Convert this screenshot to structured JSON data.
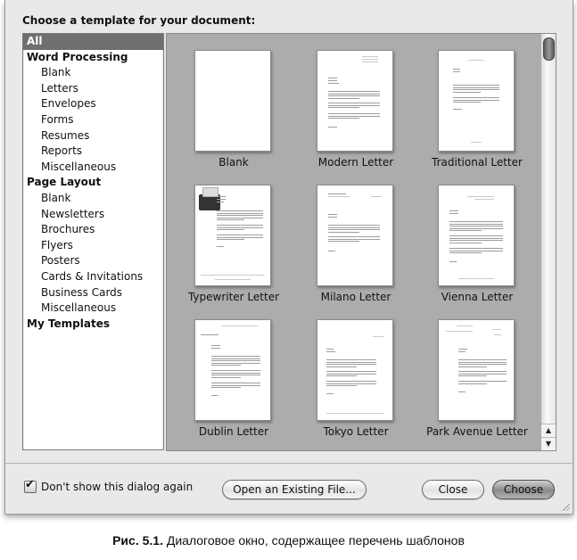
{
  "dialog": {
    "prompt": "Choose a template for your document:"
  },
  "sidebar": {
    "items": [
      {
        "label": "All",
        "type": "group",
        "selected": true
      },
      {
        "label": "Word Processing",
        "type": "group"
      },
      {
        "label": "Blank",
        "type": "sub"
      },
      {
        "label": "Letters",
        "type": "sub"
      },
      {
        "label": "Envelopes",
        "type": "sub"
      },
      {
        "label": "Forms",
        "type": "sub"
      },
      {
        "label": "Resumes",
        "type": "sub"
      },
      {
        "label": "Reports",
        "type": "sub"
      },
      {
        "label": "Miscellaneous",
        "type": "sub"
      },
      {
        "label": "Page Layout",
        "type": "group"
      },
      {
        "label": "Blank",
        "type": "sub"
      },
      {
        "label": "Newsletters",
        "type": "sub"
      },
      {
        "label": "Brochures",
        "type": "sub"
      },
      {
        "label": "Flyers",
        "type": "sub"
      },
      {
        "label": "Posters",
        "type": "sub"
      },
      {
        "label": "Cards & Invitations",
        "type": "sub"
      },
      {
        "label": "Business Cards",
        "type": "sub"
      },
      {
        "label": "Miscellaneous",
        "type": "sub"
      },
      {
        "label": "My Templates",
        "type": "group"
      }
    ]
  },
  "templates": [
    {
      "label": "Blank",
      "style": "blank"
    },
    {
      "label": "Modern Letter",
      "style": "modern"
    },
    {
      "label": "Traditional Letter",
      "style": "traditional"
    },
    {
      "label": "Typewriter Letter",
      "style": "typewriter"
    },
    {
      "label": "Milano Letter",
      "style": "milano"
    },
    {
      "label": "Vienna Letter",
      "style": "vienna"
    },
    {
      "label": "Dublin Letter",
      "style": "dublin"
    },
    {
      "label": "Tokyo Letter",
      "style": "tokyo"
    },
    {
      "label": "Park Avenue Letter",
      "style": "parkavenue"
    }
  ],
  "scrollbar": {
    "up_icon": "▲",
    "down_icon": "▼",
    "position_fraction": 0.0
  },
  "footer": {
    "checkbox_label": "Don't show this dialog again",
    "checkbox_checked": true,
    "checkmark": "✔",
    "open_existing_label": "Open an Existing File...",
    "close_label": "Close",
    "choose_label": "Choose"
  },
  "caption": {
    "prefix": "Рис. 5.1.",
    "text": " Диалоговое окно, содержащее перечень шаблонов"
  }
}
